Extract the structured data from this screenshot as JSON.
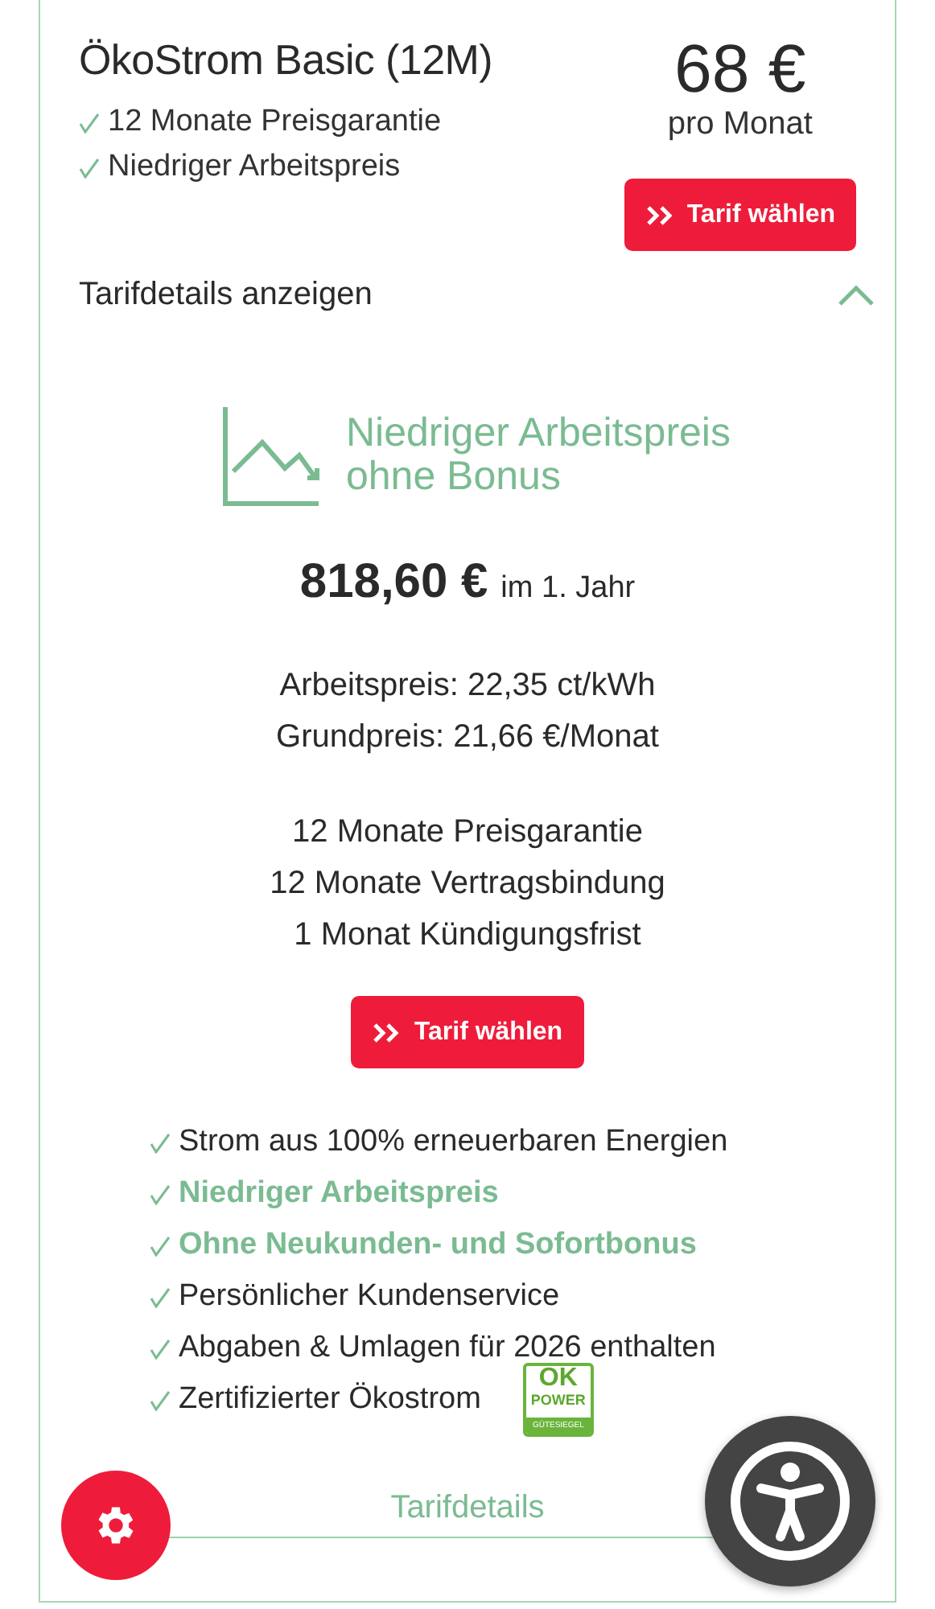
{
  "tariff": {
    "name": "ÖkoStrom Basic (12M)",
    "highlights": [
      "12 Monate Preisgarantie",
      "Niedriger Arbeitspreis"
    ],
    "price": "68 €",
    "price_unit": "pro Monat",
    "select_button": "Tarif wählen"
  },
  "details_toggle": {
    "label": "Tarifdetails anzeigen",
    "expanded": true
  },
  "details": {
    "heading_line_1": "Niedriger Arbeitspreis",
    "heading_line_2": "ohne Bonus",
    "annual_amount": "818,60 €",
    "annual_label": "im 1. Jahr",
    "prices": [
      "Arbeitspreis: 22,35 ct/kWh",
      "Grundpreis: 21,66 €/Monat"
    ],
    "terms": [
      "12 Monate Preisgarantie",
      "12 Monate Vertragsbindung",
      "1 Monat Kündigungsfrist"
    ],
    "select_button": "Tarif wählen",
    "features": [
      {
        "text": "Strom aus 100% erneuerbaren Energien",
        "highlighted": false
      },
      {
        "text": "Niedriger Arbeitspreis",
        "highlighted": true
      },
      {
        "text": "Ohne Neukunden- und Sofortbonus",
        "highlighted": true
      },
      {
        "text": "Persönlicher Kundenservice",
        "highlighted": false
      },
      {
        "text": "Abgaben & Umlagen für 2026 enthalten",
        "highlighted": false
      },
      {
        "text": "Zertifizierter Ökostrom",
        "highlighted": false,
        "seal": {
          "top": "OK",
          "middle": "POWER",
          "bottom": "GÜTESIEGEL"
        }
      }
    ],
    "footer_tab": "Tarifdetails"
  }
}
